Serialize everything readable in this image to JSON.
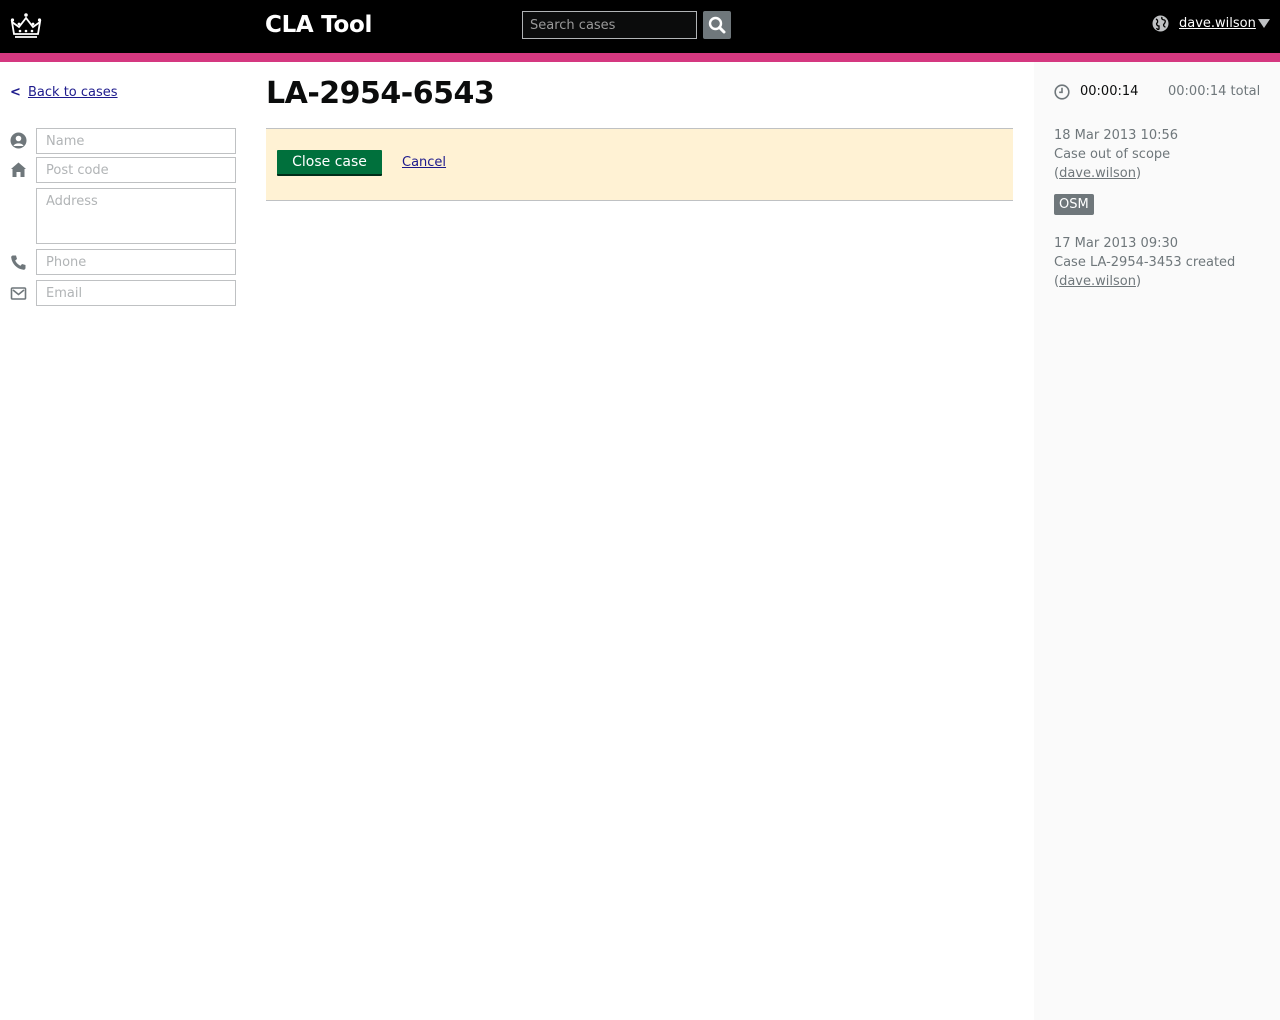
{
  "header": {
    "app_title": "CLA Tool",
    "search_placeholder": "Search cases",
    "user_name": "dave.wilson",
    "brand_color": "#d53880"
  },
  "sidebar": {
    "back_label": "Back to cases",
    "fields": {
      "name_placeholder": "Name",
      "postcode_placeholder": "Post code",
      "address_placeholder": "Address",
      "phone_placeholder": "Phone",
      "email_placeholder": "Email"
    }
  },
  "main": {
    "case_reference": "LA-2954-6543",
    "close_button_label": "Close case",
    "cancel_label": "Cancel",
    "panel_color": "#fff2d4",
    "button_color": "#00703c"
  },
  "timeline": {
    "timer": "00:00:14",
    "timer_total": "00:00:14 total",
    "events": [
      {
        "date": "18 Mar 2013 10:56",
        "description": "Case out of scope",
        "user": "dave.wilson",
        "tag": "OSM"
      },
      {
        "date": "17 Mar 2013 09:30",
        "description": "Case LA-2954-3453 created",
        "user": "dave.wilson"
      }
    ]
  }
}
